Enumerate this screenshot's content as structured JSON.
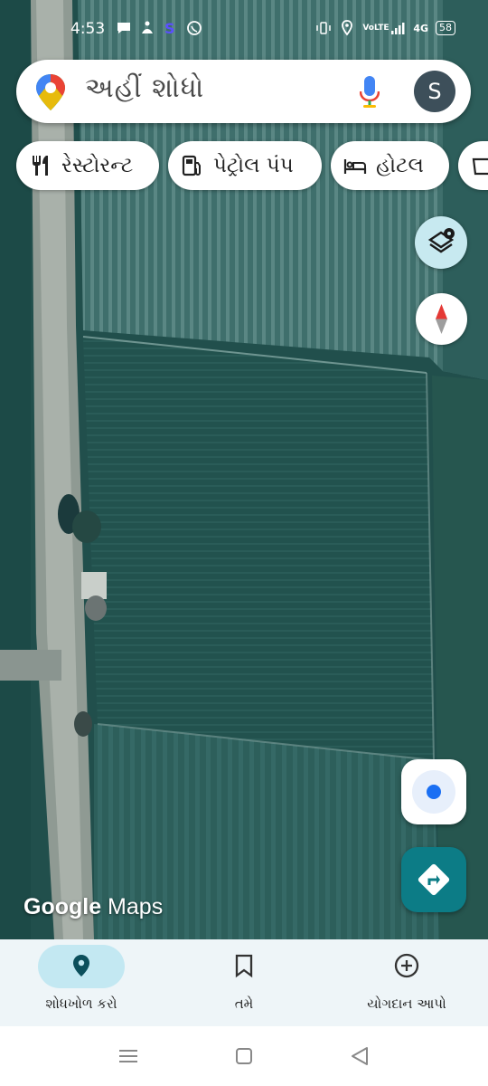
{
  "status_bar": {
    "time": "4:53",
    "left_icons": [
      "chat-bubble-icon",
      "meditation-icon",
      "s-app-icon",
      "whatsapp-icon"
    ],
    "right_icons": [
      "vibrate-icon",
      "location-icon",
      "volte-icon",
      "signal-icon",
      "4g-signal-icon"
    ],
    "volte_text": "VoLTE",
    "network_text": "4G",
    "battery": "58"
  },
  "search": {
    "placeholder": "અહીં શોધો",
    "avatar_letter": "S"
  },
  "chips": [
    {
      "label": "રેસ્ટોરન્ટ",
      "icon": "restaurant-icon"
    },
    {
      "label": "પેટ્રોલ પંપ",
      "icon": "gas-station-icon"
    },
    {
      "label": "હોટલ",
      "icon": "bed-icon"
    },
    {
      "label": "",
      "icon": "shopping-icon"
    }
  ],
  "map": {
    "type": "satellite",
    "logo_part1": "Google",
    "logo_part2": " Maps"
  },
  "bottom_nav": [
    {
      "label": "શોધખોળ કરો",
      "icon": "explore-pin-icon",
      "active": true
    },
    {
      "label": "તમે",
      "icon": "bookmark-icon",
      "active": false
    },
    {
      "label": "યોગદાન આપો",
      "icon": "add-circle-icon",
      "active": false
    }
  ],
  "colors": {
    "accent_teal": "#0c7c86",
    "location_blue": "#1a6ff3",
    "nav_active_pill": "#c3e8f2",
    "layers_button_bg": "#c7e9f0"
  }
}
